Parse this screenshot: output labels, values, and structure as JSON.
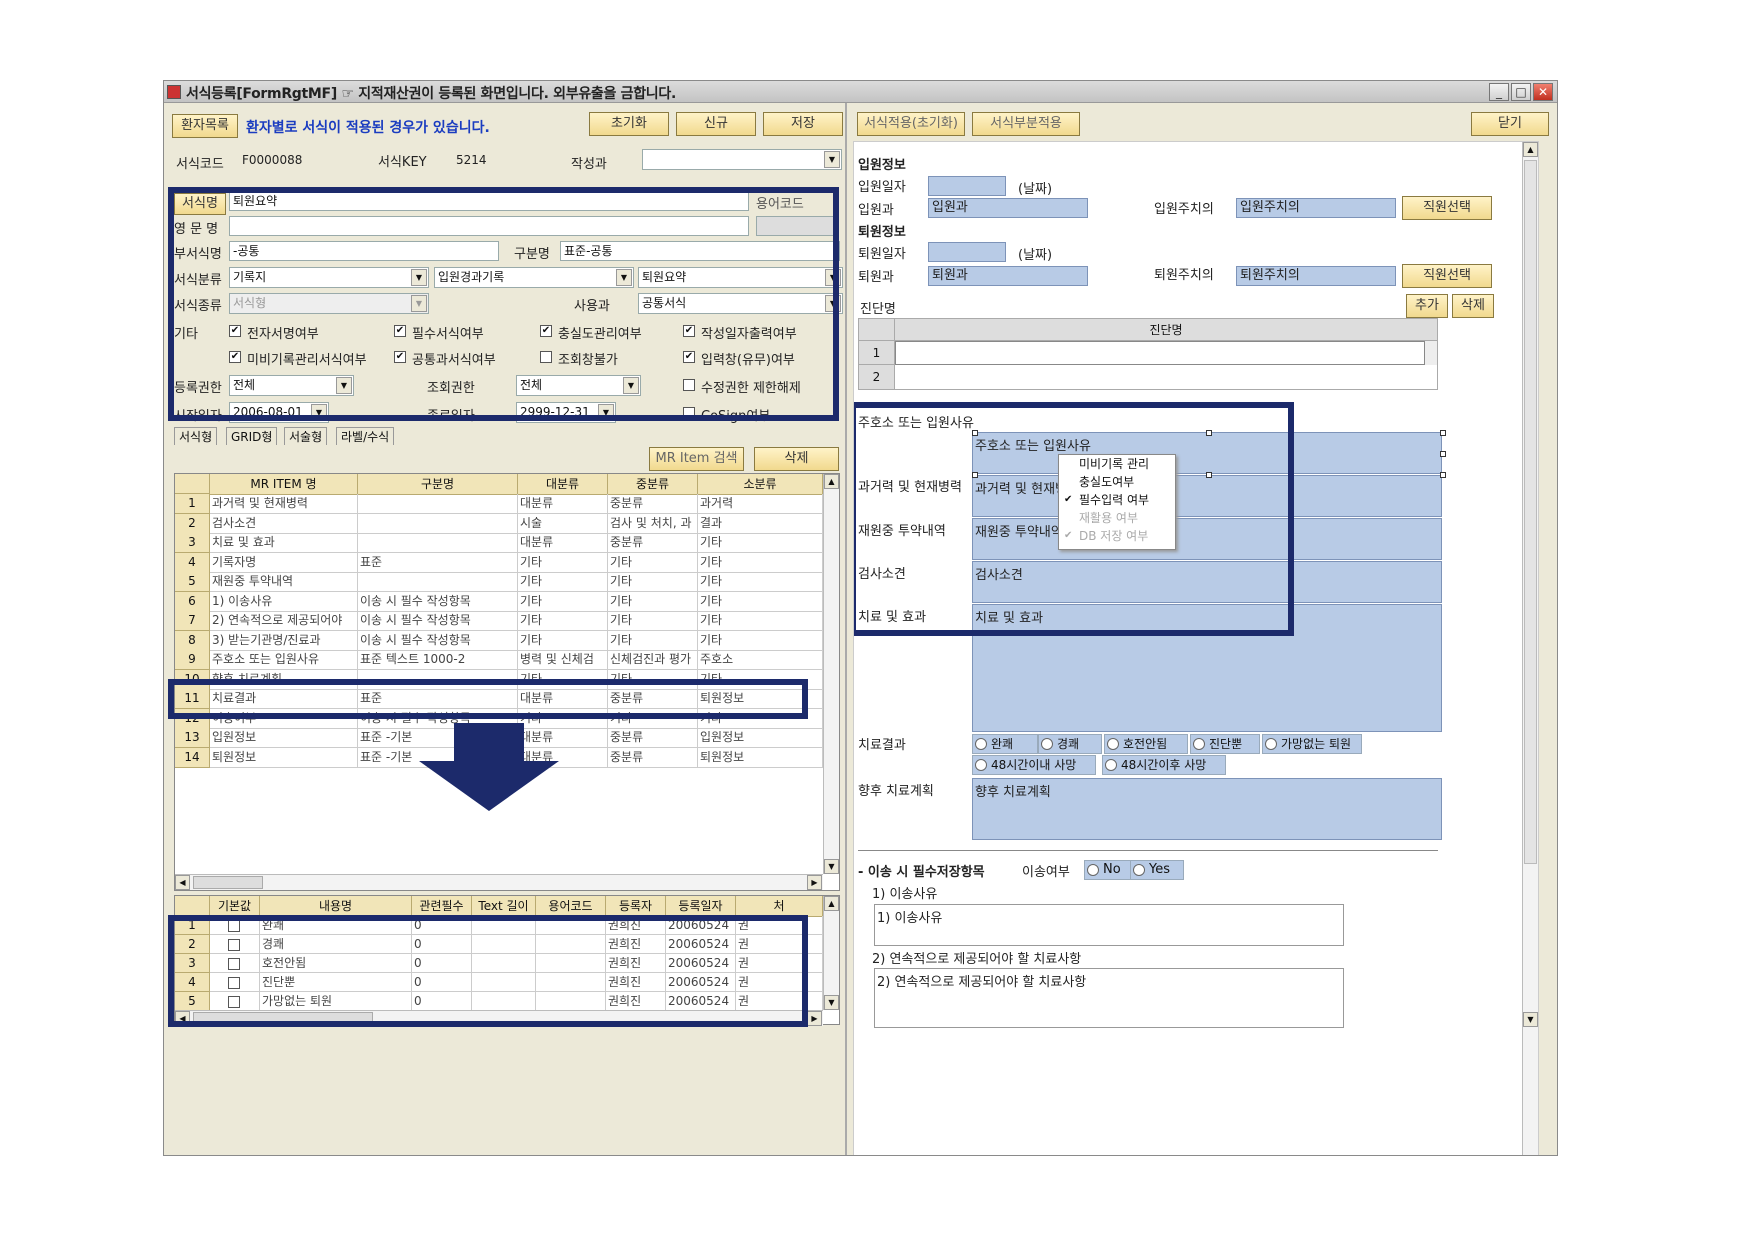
{
  "window": {
    "title": "서식등록[FormRgtMF]  ☞ 지적재산권이 등록된 화면입니다. 외부유출을 금합니다."
  },
  "toolbar_left": {
    "patients": "환자목록",
    "notice": "환자별로 서식이 적용된 경우가 있습니다.",
    "reset": "초기화",
    "new": "신규",
    "save": "저장"
  },
  "toolbar_right": {
    "apply_init": "서식적용(초기화)",
    "apply_partial": "서식부분적용",
    "close": "닫기"
  },
  "form": {
    "code_label": "서식코드",
    "code": "F0000088",
    "key_label": "서식KEY",
    "key": "5214",
    "dept_label": "작성과",
    "dept": "",
    "name_label": "서식명",
    "name": "퇴원요약",
    "term_label": "용어코드",
    "eng_label": "영 문 명",
    "eng": "",
    "sub_label": "부서식명",
    "sub": "-공통",
    "group_label": "구분명",
    "group": "표준-공통",
    "class_label": "서식분류",
    "class1": "기록지",
    "class2": "입원경과기록",
    "class3": "퇴원요약",
    "type_label": "서식종류",
    "type": "서식형",
    "usedept_label": "사용과",
    "usedept": "공통서식",
    "etc_label": "기타",
    "checks": [
      {
        "label": "전자서명여부",
        "checked": "✔"
      },
      {
        "label": "필수서식여부",
        "checked": "✔"
      },
      {
        "label": "충실도관리여부",
        "checked": "✔"
      },
      {
        "label": "작성일자출력여부",
        "checked": "✔"
      },
      {
        "label": "미비기록관리서식여부",
        "checked": "✔"
      },
      {
        "label": "공통과서식여부",
        "checked": "✔"
      },
      {
        "label": "조회창불가",
        "checked": ""
      },
      {
        "label": "입력창(유무)여부",
        "checked": "✔"
      }
    ],
    "reg_label": "등록권한",
    "reg": "전체",
    "view_label": "조회권한",
    "view": "전체",
    "edit_limit": "수정권한 제한해제",
    "start_label": "시작일자",
    "start": "2006-08-01",
    "end_label": "종료일자",
    "end": "2999-12-31",
    "cosign": "CoSign여부"
  },
  "tabs": [
    "서식형",
    "GRID형",
    "서술형",
    "라벨/수식"
  ],
  "mr_search": "MR Item 검색",
  "delete": "삭제",
  "item_grid": {
    "headers": [
      "MR ITEM 명",
      "구분명",
      "대분류",
      "중분류",
      "소분류"
    ],
    "rows": [
      [
        "1",
        "과거력 및 현재병력",
        "",
        "대분류",
        "중분류",
        "과거력"
      ],
      [
        "2",
        "검사소견",
        "",
        "시술",
        "검사 및 처치, 과",
        "결과"
      ],
      [
        "3",
        "치료 및 효과",
        "",
        "대분류",
        "중분류",
        "기타"
      ],
      [
        "4",
        "기록자명",
        "표준",
        "기타",
        "기타",
        "기타"
      ],
      [
        "5",
        "재원중 투약내역",
        "",
        "기타",
        "기타",
        "기타"
      ],
      [
        "6",
        "1) 이송사유",
        "이송 시 필수 작성항목",
        "기타",
        "기타",
        "기타"
      ],
      [
        "7",
        "2) 연속적으로 제공되어야",
        "이송 시 필수 작성항목",
        "기타",
        "기타",
        "기타"
      ],
      [
        "8",
        "3) 받는기관명/진료과",
        "이송 시 필수 작성항목",
        "기타",
        "기타",
        "기타"
      ],
      [
        "9",
        "주호소 또는 입원사유",
        "표준 텍스트 1000-2",
        "병력 및 신체검",
        "신체검진과 평가",
        "주호소"
      ],
      [
        "10",
        "향후 치료계획",
        "",
        "기타",
        "기타",
        "기타"
      ],
      [
        "11",
        "치료결과",
        "표준",
        "대분류",
        "중분류",
        "퇴원정보"
      ],
      [
        "12",
        "이송여부",
        "이송 시 필수 작성항목",
        "기타",
        "기타",
        "기타"
      ],
      [
        "13",
        "입원정보",
        "표준 -기본",
        "대분류",
        "중분류",
        "입원정보"
      ],
      [
        "14",
        "퇴원정보",
        "표준 -기본",
        "대분류",
        "중분류",
        "퇴원정보"
      ]
    ]
  },
  "content_grid": {
    "headers": [
      "기본값",
      "내용명",
      "관련필수",
      "Text 길이",
      "용어코드",
      "등록자",
      "등록일자",
      "처"
    ],
    "rows": [
      [
        "1",
        "완쾌",
        "0",
        "권희진",
        "20060524",
        "권"
      ],
      [
        "2",
        "경쾌",
        "0",
        "권희진",
        "20060524",
        "권"
      ],
      [
        "3",
        "호전안됨",
        "0",
        "권희진",
        "20060524",
        "권"
      ],
      [
        "4",
        "진단뿐",
        "0",
        "권희진",
        "20060524",
        "권"
      ],
      [
        "5",
        "가망없는 퇴원",
        "0",
        "권희진",
        "20060524",
        "권"
      ]
    ]
  },
  "preview": {
    "admit_section": "입원정보",
    "admit_date_label": "입원일자",
    "date_hint": "(날짜)",
    "admit_dept_label": "입원과",
    "admit_dept": "입원과",
    "admit_doc_label": "입원주치의",
    "admit_doc": "입원주치의",
    "select_staff": "직원선택",
    "discharge_section": "퇴원정보",
    "dis_date_label": "퇴원일자",
    "dis_dept_label": "퇴원과",
    "dis_dept": "퇴원과",
    "dis_doc_label": "퇴원주치의",
    "dis_doc": "퇴원주치의",
    "diag_label": "진단명",
    "add": "추가",
    "del": "삭제",
    "diag_header": "진단명",
    "diag_rows": [
      "1",
      "2"
    ],
    "chief_label": "주호소 또는 입원사유",
    "chief_box": "주호소 또는 입원사유",
    "history_label": "과거력 및 현재병력",
    "history_box": "과거력 및 현재병",
    "meds_label": "재원중 투약내역",
    "meds_box": "재원중 투약내약",
    "exam_label": "검사소견",
    "exam_box": "검사소견",
    "effect_label": "치료 및 효과",
    "effect_box": "치료 및 효과",
    "result_label": "치료결과",
    "results": [
      "완쾌",
      "경쾌",
      "호전안됨",
      "진단뿐",
      "가망없는 퇴원",
      "48시간이내 사망",
      "48시간이후 사망"
    ],
    "plan_label": "향후 치료계획",
    "plan_box": "향후 치료계획",
    "transfer_label": "- 이송 시 필수저장항목",
    "transfer_q": "이송여부",
    "no": "No",
    "yes": "Yes",
    "reason_label": "1) 이송사유",
    "reason_box": "1) 이송사유",
    "continue_label": "2) 연속적으로 제공되어야 할 치료사항",
    "continue_box": "2) 연속적으로 제공되어야 할 치료사항"
  },
  "context_menu": [
    {
      "label": "미비기록 관리",
      "check": "",
      "disabled": false
    },
    {
      "label": "충실도여부",
      "check": "",
      "disabled": false
    },
    {
      "label": "필수입력 여부",
      "check": "✔",
      "disabled": false
    },
    {
      "label": "재활용 여부",
      "check": "",
      "disabled": true
    },
    {
      "label": "DB 저장 여부",
      "check": "✔",
      "disabled": true
    }
  ],
  "colors": {
    "navy": "#1c2a6b",
    "field_blue": "#b8cbe6",
    "button": "#f1d98e",
    "header": "#f1e5b8"
  }
}
